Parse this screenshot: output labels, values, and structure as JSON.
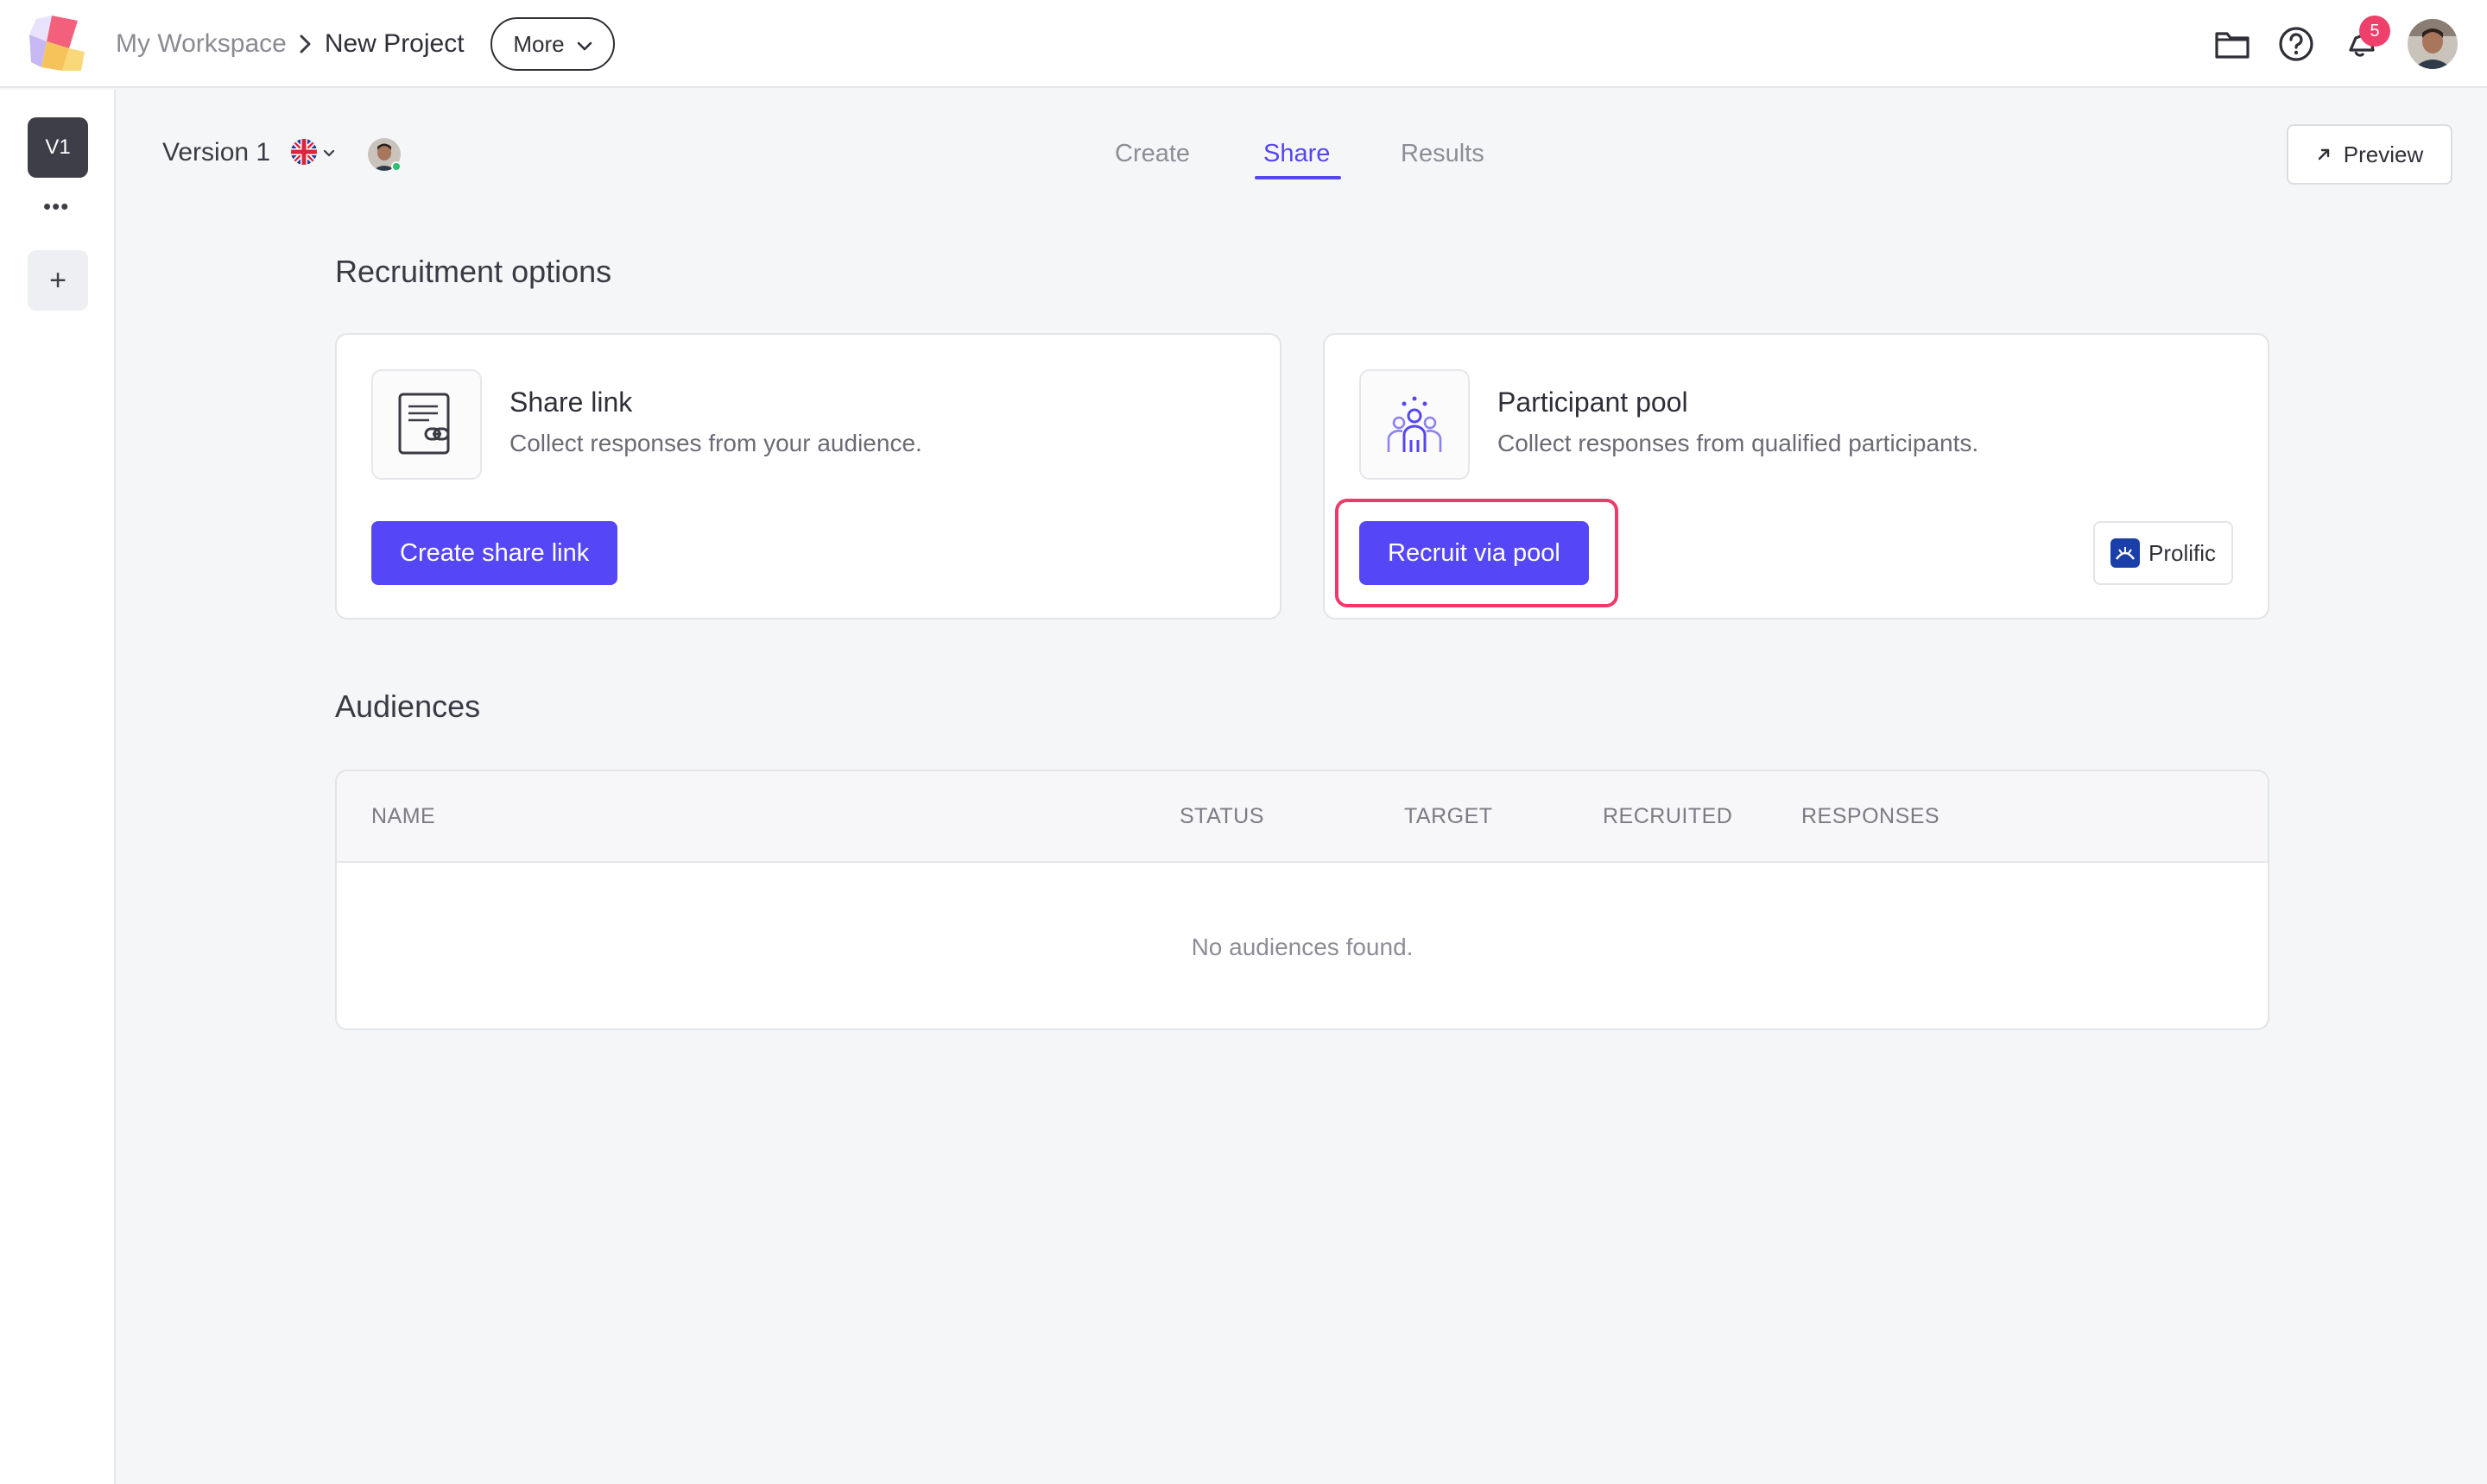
{
  "header": {
    "breadcrumb": {
      "workspace": "My Workspace",
      "project": "New Project"
    },
    "more_label": "More",
    "notifications_count": "5"
  },
  "rail": {
    "version_chip": "V1",
    "dots": "•••",
    "add": "+"
  },
  "subheader": {
    "version_label": "Version 1",
    "tabs": [
      {
        "label": "Create",
        "active": false
      },
      {
        "label": "Share",
        "active": true
      },
      {
        "label": "Results",
        "active": false
      }
    ],
    "preview_label": "Preview"
  },
  "recruitment": {
    "title": "Recruitment options",
    "share_link": {
      "title": "Share link",
      "description": "Collect responses from your audience.",
      "button": "Create share link"
    },
    "participant_pool": {
      "title": "Participant pool",
      "description": "Collect responses from qualified participants.",
      "button": "Recruit via pool",
      "provider": "Prolific"
    }
  },
  "audiences": {
    "title": "Audiences",
    "columns": [
      "NAME",
      "STATUS",
      "TARGET",
      "RECRUITED",
      "RESPONSES"
    ],
    "empty_message": "No audiences found."
  },
  "colors": {
    "accent": "#5546f0",
    "highlight": "#ee3a6a",
    "badge": "#ef3f6b"
  },
  "icons": {
    "folder": "folder-icon",
    "help": "help-icon",
    "notifications": "notification-icon",
    "share_link": "link-document-icon",
    "participant_pool": "people-group-icon"
  }
}
